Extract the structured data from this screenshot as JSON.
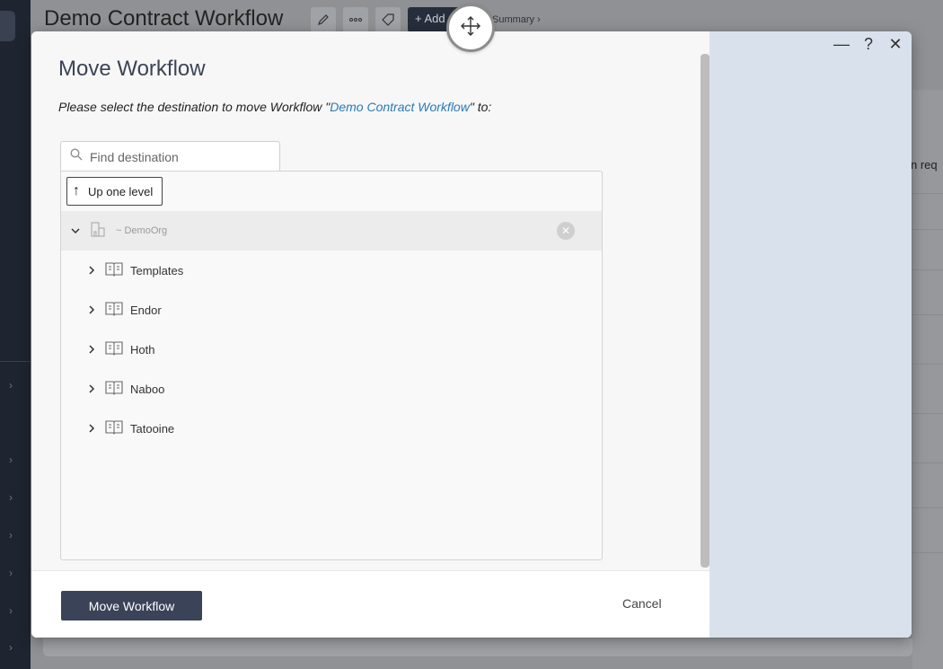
{
  "background": {
    "page_title": "Demo Contract Workflow",
    "add_label": "+ Add",
    "breadcrumb_summary": "Summary ›",
    "right_text": "n req"
  },
  "modal": {
    "title": "Move Workflow",
    "instruction_prefix": "Please select the destination to move Workflow \"",
    "instruction_link": "Demo Contract Workflow",
    "instruction_suffix": "\" to:",
    "window_controls": {
      "minimize": "—",
      "help": "?",
      "close": "✕"
    },
    "search": {
      "placeholder": "Find destination",
      "value": ""
    },
    "up_button": {
      "icon": "↑",
      "label": "Up one level"
    },
    "root": {
      "label": "~ DemoOrg",
      "icon": "building-icon",
      "expanded": true
    },
    "items": [
      {
        "label": "Templates",
        "icon": "book-icon"
      },
      {
        "label": "Endor",
        "icon": "book-icon"
      },
      {
        "label": "Hoth",
        "icon": "book-icon"
      },
      {
        "label": "Naboo",
        "icon": "book-icon"
      },
      {
        "label": "Tatooine",
        "icon": "book-icon"
      }
    ],
    "footer": {
      "primary_label": "Move Workflow",
      "cancel_label": "Cancel"
    }
  },
  "colors": {
    "primary": "#3a4358",
    "link": "#2a7ab9",
    "side_panel": "#d9e2ec"
  }
}
